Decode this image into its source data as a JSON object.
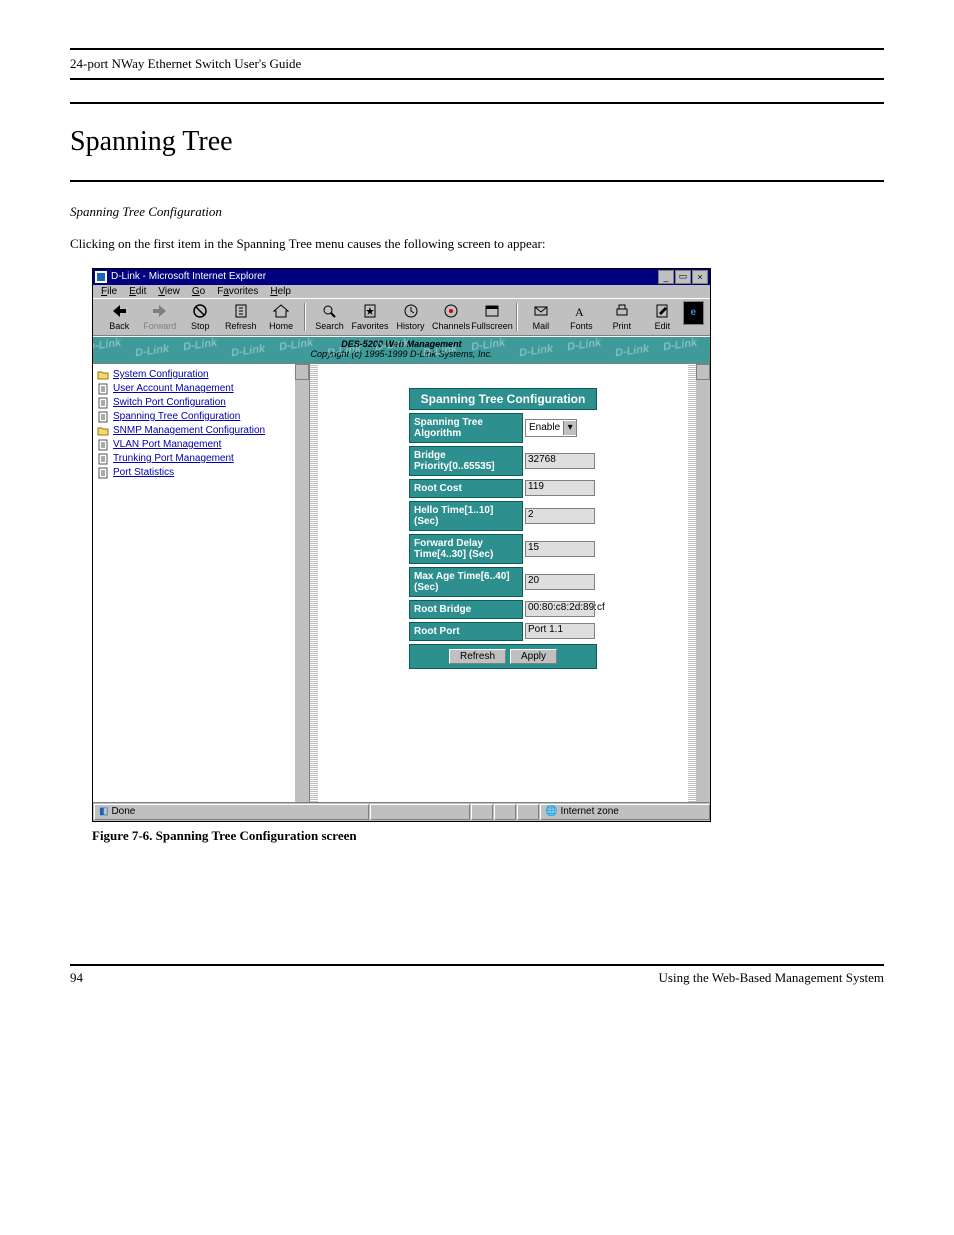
{
  "doc_header": {
    "left": "24-port NWay Ethernet Switch User's Guide",
    "right": ""
  },
  "section": {
    "title": "Spanning Tree",
    "subtitle": "Spanning Tree Configuration",
    "paragraph": "Clicking on the first item in the Spanning Tree menu causes the following screen to appear:"
  },
  "window": {
    "title": "D-Link - Microsoft Internet Explorer",
    "buttons": {
      "min": "_",
      "max": "▭",
      "close": "×"
    }
  },
  "menubar": [
    "File",
    "Edit",
    "View",
    "Go",
    "Favorites",
    "Help"
  ],
  "toolbar": [
    {
      "label": "Back",
      "icon": "back-icon",
      "disabled": false
    },
    {
      "label": "Forward",
      "icon": "forward-icon",
      "disabled": true
    },
    {
      "label": "Stop",
      "icon": "stop-icon",
      "disabled": false
    },
    {
      "label": "Refresh",
      "icon": "refresh-icon",
      "disabled": false
    },
    {
      "label": "Home",
      "icon": "home-icon",
      "disabled": false
    },
    {
      "label": "Search",
      "icon": "search-icon",
      "disabled": false
    },
    {
      "label": "Favorites",
      "icon": "favorites-icon",
      "disabled": false
    },
    {
      "label": "History",
      "icon": "history-icon",
      "disabled": false
    },
    {
      "label": "Channels",
      "icon": "channels-icon",
      "disabled": false
    },
    {
      "label": "Fullscreen",
      "icon": "fullscreen-icon",
      "disabled": false
    },
    {
      "label": "Mail",
      "icon": "mail-icon",
      "disabled": false
    },
    {
      "label": "Fonts",
      "icon": "fonts-icon",
      "disabled": false
    },
    {
      "label": "Print",
      "icon": "print-icon",
      "disabled": false
    },
    {
      "label": "Edit",
      "icon": "edit-icon",
      "disabled": false
    }
  ],
  "banner": {
    "line1": "DES-5200 Web Management",
    "line2": "Copyright (c) 1995-1999 D-Link Systems, Inc.",
    "wm": "D-Link"
  },
  "sidebar": [
    {
      "label": "System Configuration",
      "icon": "folder-icon"
    },
    {
      "label": "User Account Management",
      "icon": "page-icon"
    },
    {
      "label": "Switch Port Configuration",
      "icon": "page-icon"
    },
    {
      "label": "Spanning Tree Configuration",
      "icon": "page-icon"
    },
    {
      "label": "SNMP Management Configuration",
      "icon": "folder-icon"
    },
    {
      "label": "VLAN Port Management",
      "icon": "page-icon"
    },
    {
      "label": "Trunking Port Management",
      "icon": "page-icon"
    },
    {
      "label": "Port Statistics",
      "icon": "page-icon"
    }
  ],
  "panel": {
    "title": "Spanning Tree Configuration",
    "rows": [
      {
        "label": "Spanning Tree Algorithm",
        "value": "Enable",
        "type": "select"
      },
      {
        "label": "Bridge Priority[0..65535]",
        "value": "32768",
        "type": "input"
      },
      {
        "label": "Root Cost",
        "value": "119",
        "type": "readonly"
      },
      {
        "label": "Hello Time[1..10] (Sec)",
        "value": "2",
        "type": "input"
      },
      {
        "label": "Forward Delay Time[4..30] (Sec)",
        "value": "15",
        "type": "input"
      },
      {
        "label": "Max Age Time[6..40] (Sec)",
        "value": "20",
        "type": "input"
      },
      {
        "label": "Root Bridge",
        "value": "00:80:c8:2d:89:cf",
        "type": "readonly"
      },
      {
        "label": "Root Port",
        "value": "Port 1.1",
        "type": "readonly"
      }
    ],
    "buttons": {
      "refresh": "Refresh",
      "apply": "Apply"
    }
  },
  "statusbar": {
    "left": "Done",
    "zone": "Internet zone"
  },
  "caption": "Figure 7-6.  Spanning Tree Configuration screen",
  "footer": {
    "left": "94",
    "right": "Using the Web-Based Management System"
  }
}
